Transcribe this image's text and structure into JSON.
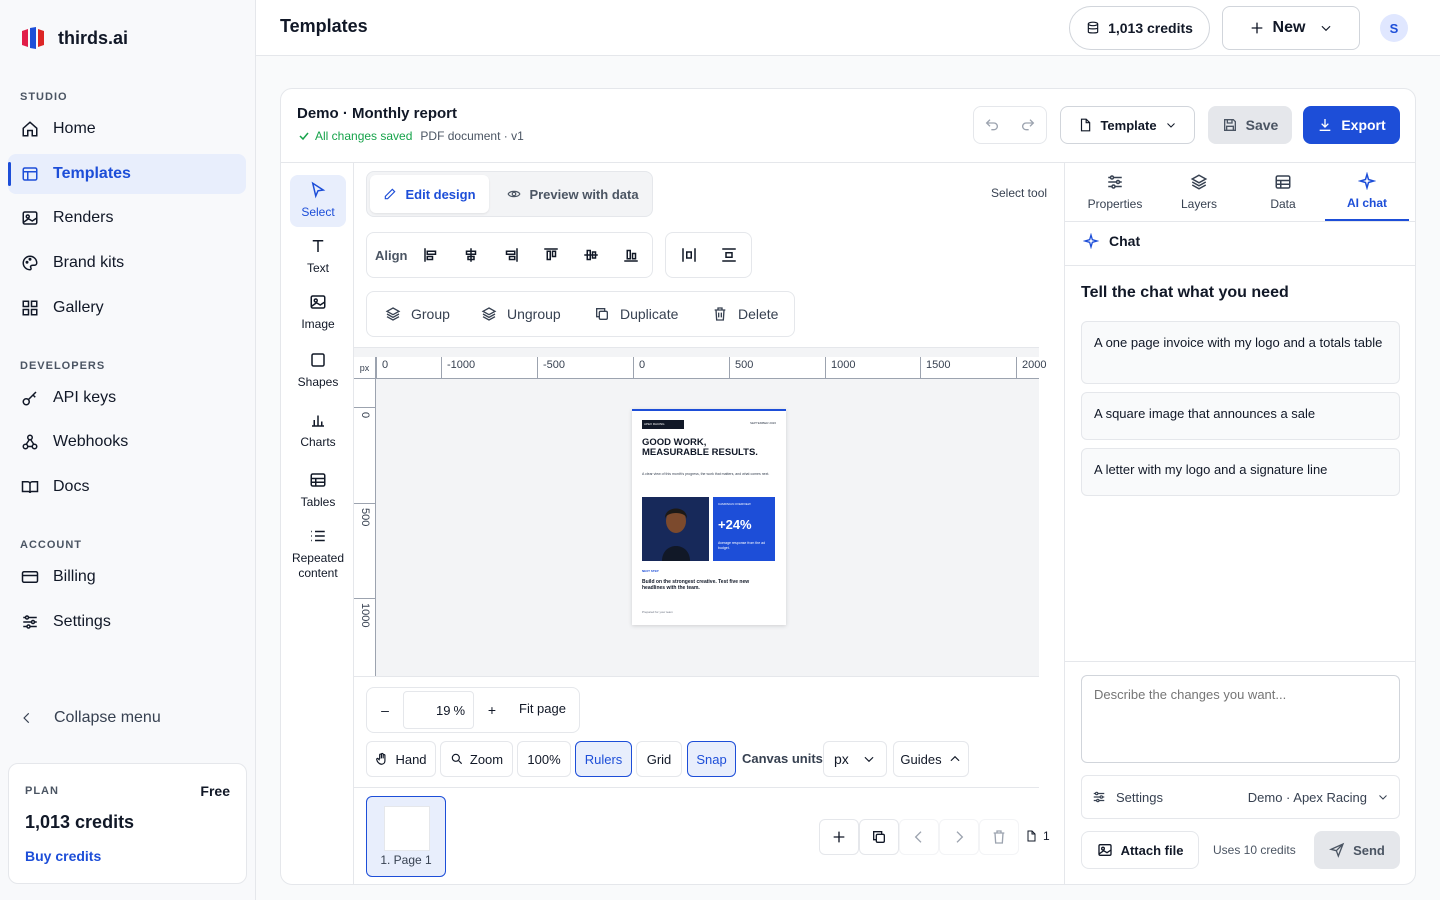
{
  "brand": {
    "name": "thirds.ai"
  },
  "sidebar": {
    "studio_label": "STUDIO",
    "studio_items": [
      {
        "label": "Home",
        "icon": "home-icon"
      },
      {
        "label": "Templates",
        "icon": "template-icon",
        "active": true
      },
      {
        "label": "Renders",
        "icon": "image-icon"
      },
      {
        "label": "Brand kits",
        "icon": "palette-icon"
      },
      {
        "label": "Gallery",
        "icon": "grid-icon"
      }
    ],
    "developers_label": "DEVELOPERS",
    "developer_items": [
      {
        "label": "API keys",
        "icon": "key-icon"
      },
      {
        "label": "Webhooks",
        "icon": "webhook-icon"
      },
      {
        "label": "Docs",
        "icon": "book-icon"
      }
    ],
    "account_label": "ACCOUNT",
    "account_items": [
      {
        "label": "Billing",
        "icon": "card-icon"
      },
      {
        "label": "Settings",
        "icon": "sliders-icon"
      }
    ],
    "collapse_label": "Collapse menu",
    "plan": {
      "label": "PLAN",
      "tier": "Free",
      "credits": "1,013 credits",
      "buy_label": "Buy credits"
    }
  },
  "header": {
    "title": "Templates",
    "credits_label": "1,013 credits",
    "new_label": "New",
    "avatar_initial": "S"
  },
  "document": {
    "title": "Demo · Monthly report",
    "save_status": "All changes saved",
    "meta": "PDF document · v1",
    "template_label": "Template",
    "save_label": "Save",
    "export_label": "Export"
  },
  "tools": [
    {
      "label": "Select",
      "icon": "cursor-icon",
      "active": true
    },
    {
      "label": "Text",
      "icon": "text-icon"
    },
    {
      "label": "Image",
      "icon": "image-icon"
    },
    {
      "label": "Shapes",
      "icon": "square-icon"
    },
    {
      "label": "Charts",
      "icon": "chart-icon"
    },
    {
      "label": "Tables",
      "icon": "table-icon"
    },
    {
      "label": "Repeated content",
      "icon": "list-icon"
    }
  ],
  "modes": {
    "edit_label": "Edit design",
    "preview_label": "Preview with data",
    "select_tool_label": "Select tool"
  },
  "align": {
    "label": "Align"
  },
  "actions": {
    "group": "Group",
    "ungroup": "Ungroup",
    "duplicate": "Duplicate",
    "delete": "Delete"
  },
  "ruler": {
    "unit": "px",
    "h_ticks": [
      "0",
      "-1000",
      "-500",
      "0",
      "500",
      "1000",
      "1500",
      "2000"
    ],
    "v_ticks": [
      "0",
      "500",
      "1000"
    ]
  },
  "preview": {
    "badge": "APEX RACING",
    "date": "SEPTEMBER 2026",
    "headline": "GOOD WORK, MEASURABLE RESULTS.",
    "intro": "A clear view of this month's progress, the work that matters, and what comes next.",
    "card_label": "CAMPAIGN OVERVIEW",
    "stat": "+24%",
    "stat_note": "Average response from the ad budget.",
    "next_label": "NEXT STEP",
    "next_text": "Build on the strongest creative. Test five new headlines with the team.",
    "footer": "Prepared for your team"
  },
  "zoom": {
    "minus": "–",
    "value": "19",
    "unit": "%",
    "plus": "+",
    "fit_label": "Fit page"
  },
  "canvas_controls": {
    "hand": "Hand",
    "zoom": "Zoom",
    "hundred": "100%",
    "rulers": "Rulers",
    "grid": "Grid",
    "snap": "Snap",
    "units_label": "Canvas units",
    "units_value": "px",
    "guides": "Guides"
  },
  "pages": {
    "thumb_label": "1. Page 1",
    "count": "1"
  },
  "right_tabs": [
    {
      "label": "Properties",
      "icon": "sliders-icon"
    },
    {
      "label": "Layers",
      "icon": "layers-icon"
    },
    {
      "label": "Data",
      "icon": "table-icon"
    },
    {
      "label": "AI chat",
      "icon": "sparkle-icon",
      "active": true
    }
  ],
  "chat": {
    "title": "Chat",
    "heading": "Tell the chat what you need",
    "suggestions": [
      "A one page invoice with my logo and a totals table",
      "A square image that announces a sale",
      "A letter with my logo and a signature line"
    ],
    "input_placeholder": "Describe the changes you want...",
    "settings_label": "Settings",
    "settings_value": "Demo · Apex Racing",
    "attach_label": "Attach file",
    "credits_note": "Uses 10 credits",
    "send_label": "Send"
  },
  "colors": {
    "accent": "#1d4ed8",
    "success": "#16a34a"
  }
}
